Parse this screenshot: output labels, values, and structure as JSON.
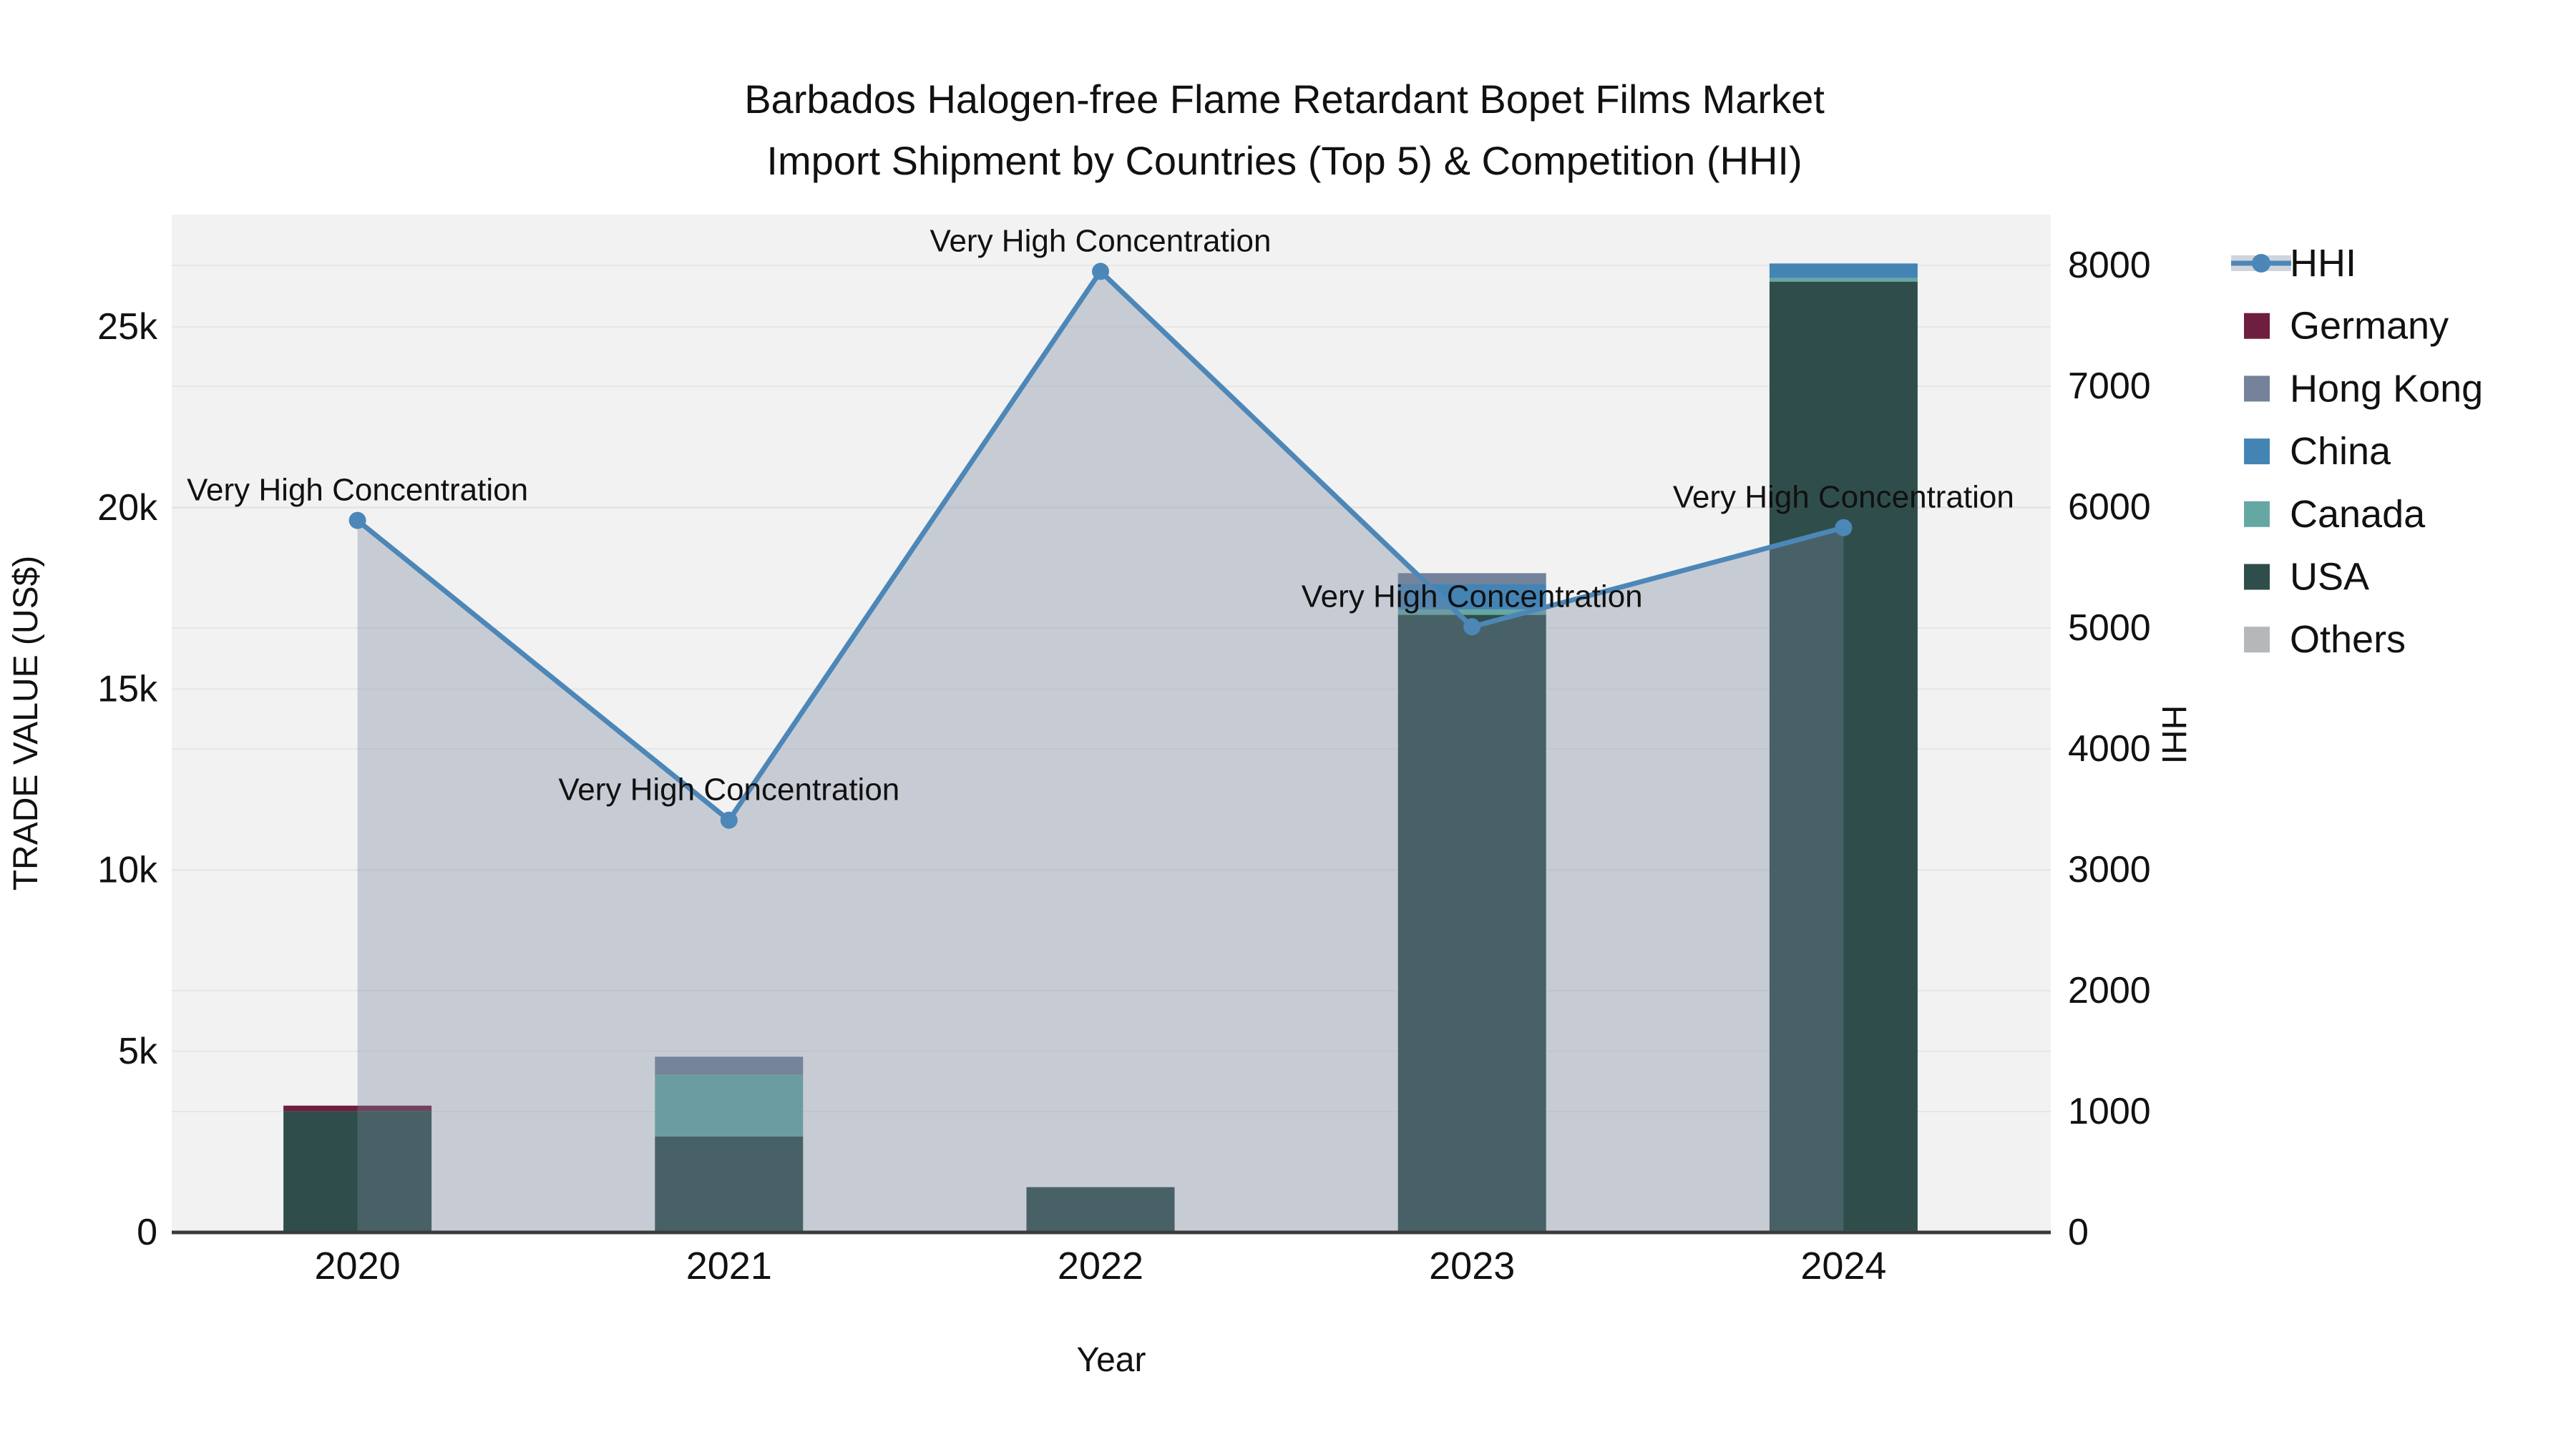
{
  "title": {
    "line1": "Barbados Halogen-free Flame Retardant Bopet Films Market",
    "line2": "Import Shipment by Countries (Top 5) & Competition (HHI)"
  },
  "colors": {
    "plot_background": "#f2f2f2",
    "gridline": "#e6e6e6",
    "axis_line": "#3b3b3b",
    "hhi_line": "#4D87B8",
    "hhi_area": "rgba(120,134,158,0.35)",
    "germany": "#6E1E3F",
    "hong_kong": "#74839A",
    "china": "#4484B5",
    "canada": "#65A8A3",
    "usa": "#2F4E4B",
    "others": "#B4B8BB"
  },
  "chart_data": {
    "type": "combo_stacked_bar_line",
    "title": "Barbados Halogen-free Flame Retardant Bopet Films Market Import Shipment by Countries (Top 5) & Competition (HHI)",
    "categories": [
      "2020",
      "2021",
      "2022",
      "2023",
      "2024"
    ],
    "xlabel": "Year",
    "left_axis": {
      "label": "TRADE VALUE (US$)",
      "range": [
        0,
        28100
      ],
      "ticks": [
        {
          "value": 0,
          "label": "0"
        },
        {
          "value": 5000,
          "label": "5k"
        },
        {
          "value": 10000,
          "label": "10k"
        },
        {
          "value": 15000,
          "label": "15k"
        },
        {
          "value": 20000,
          "label": "20k"
        },
        {
          "value": 25000,
          "label": "25k"
        }
      ]
    },
    "right_axis": {
      "label": "HHI",
      "range": [
        0,
        8420
      ],
      "ticks": [
        {
          "value": 0,
          "label": "0"
        },
        {
          "value": 1000,
          "label": "1000"
        },
        {
          "value": 2000,
          "label": "2000"
        },
        {
          "value": 3000,
          "label": "3000"
        },
        {
          "value": 4000,
          "label": "4000"
        },
        {
          "value": 5000,
          "label": "5000"
        },
        {
          "value": 6000,
          "label": "6000"
        },
        {
          "value": 7000,
          "label": "7000"
        },
        {
          "value": 8000,
          "label": "8000"
        }
      ]
    },
    "bar_series_stack_bottom_to_top": [
      {
        "name": "Others",
        "color": "#B4B8BB",
        "values": [
          0,
          0,
          0,
          0,
          50
        ]
      },
      {
        "name": "USA",
        "color": "#2F4E4B",
        "values": [
          3350,
          2650,
          1250,
          17050,
          26200
        ]
      },
      {
        "name": "Canada",
        "color": "#65A8A3",
        "values": [
          0,
          1700,
          0,
          150,
          100
        ]
      },
      {
        "name": "China",
        "color": "#4484B5",
        "values": [
          0,
          0,
          0,
          700,
          400
        ]
      },
      {
        "name": "Hong Kong",
        "color": "#74839A",
        "values": [
          0,
          500,
          0,
          300,
          0
        ]
      },
      {
        "name": "Germany",
        "color": "#6E1E3F",
        "values": [
          150,
          0,
          0,
          0,
          0
        ]
      }
    ],
    "line_series": {
      "name": "HHI",
      "color": "#4D87B8",
      "area_color": "rgba(120,134,158,0.35)",
      "values": [
        5890,
        3410,
        7950,
        5010,
        5830
      ]
    },
    "annotations": [
      {
        "category": "2020",
        "text": "Very High Concentration"
      },
      {
        "category": "2021",
        "text": "Very High Concentration"
      },
      {
        "category": "2022",
        "text": "Very High Concentration"
      },
      {
        "category": "2023",
        "text": "Very High Concentration"
      },
      {
        "category": "2024",
        "text": "Very High Concentration"
      }
    ],
    "legend": {
      "position": "right",
      "entries": [
        {
          "name": "HHI",
          "type": "line",
          "color": "#4D87B8"
        },
        {
          "name": "Germany",
          "type": "swatch",
          "color": "#6E1E3F"
        },
        {
          "name": "Hong Kong",
          "type": "swatch",
          "color": "#74839A"
        },
        {
          "name": "China",
          "type": "swatch",
          "color": "#4484B5"
        },
        {
          "name": "Canada",
          "type": "swatch",
          "color": "#65A8A3"
        },
        {
          "name": "USA",
          "type": "swatch",
          "color": "#2F4E4B"
        },
        {
          "name": "Others",
          "type": "swatch",
          "color": "#B4B8BB"
        }
      ]
    }
  }
}
